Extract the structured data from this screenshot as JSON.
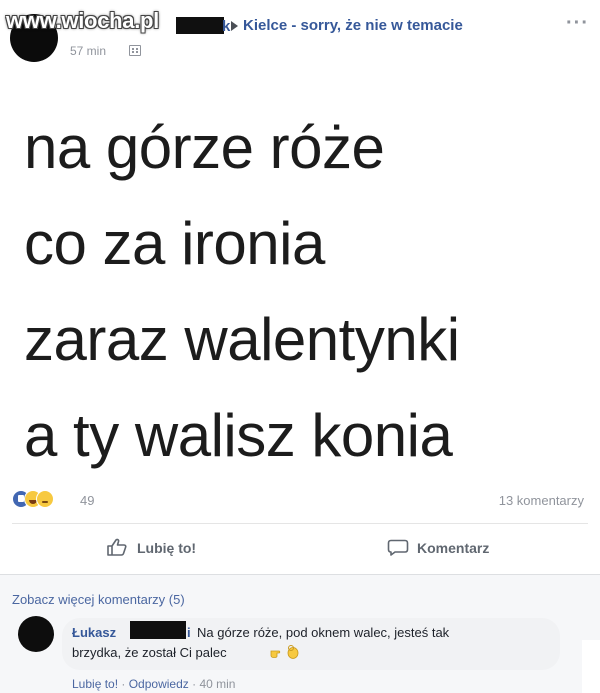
{
  "post": {
    "watermark": "www.wiocha.pl",
    "author_name_tail": "k",
    "group_name": "Kielce - sorry, że nie w temacie",
    "time": "57 min",
    "privacy_icon": "group-icon",
    "more_icon": "more-icon",
    "more_label": "···",
    "text_lines": [
      "na górze róże",
      "co za ironia",
      "zaraz walentynki",
      "a ty walisz konia"
    ],
    "reactions": [
      "like",
      "haha",
      "sad"
    ],
    "reaction_count": "49",
    "comment_count": "13 komentarzy"
  },
  "actions": {
    "like_label": "Lubię to!",
    "comment_label": "Komentarz",
    "like_icon": "thumbs-up-icon",
    "comment_icon": "speech-bubble-icon"
  },
  "comments": {
    "more_label": "Zobacz więcej komentarzy (5)",
    "items": [
      {
        "author": "Łukasz",
        "author_tail": "i",
        "text_line1": "Na górze róże, pod oknem walec, jesteś tak",
        "text_line2": "brzydka, że został Ci palec",
        "like_label": "Lubię to!",
        "sep": " · ",
        "reply_label": "Odpowiedz",
        "time": "40 min"
      }
    ]
  },
  "colors": {
    "link": "#365899",
    "meta": "#90949c",
    "like_blue": "#4267b2",
    "reaction_yellow": "#f7c940"
  }
}
